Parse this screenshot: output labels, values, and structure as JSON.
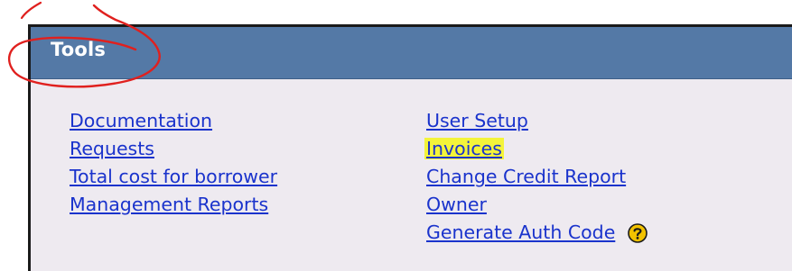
{
  "panel": {
    "title": "Tools"
  },
  "tools": {
    "left": [
      {
        "label": "Documentation"
      },
      {
        "label": "Requests"
      },
      {
        "label": "Total cost for borrower"
      },
      {
        "label": "Management Reports"
      }
    ],
    "right": [
      {
        "label": "User Setup"
      },
      {
        "label": "Invoices",
        "highlighted": true
      },
      {
        "label": "Change Credit Report"
      },
      {
        "label": "Owner"
      },
      {
        "label": "Generate Auth Code",
        "help_icon": "help-icon"
      }
    ]
  },
  "colors": {
    "header_bg": "#5479a6",
    "panel_bg": "#eeeaf0",
    "link": "#1a33cc",
    "highlight": "#f4f43a",
    "annotation": "#e0201e",
    "help_icon_fill": "#f2c200"
  }
}
